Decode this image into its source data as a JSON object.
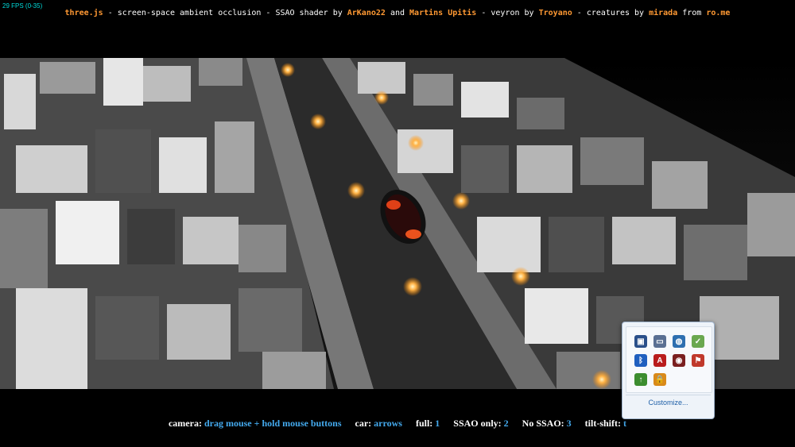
{
  "fps": "29 FPS (0-35)",
  "credits": {
    "lib": "three.js",
    "t1": " - screen-space ambient occlusion - SSAO shader by ",
    "a1": "ArKano22",
    "t2": " and ",
    "a2": "Martins Upitis",
    "t3": " - veyron by ",
    "a3": "Troyano",
    "t4": " - creatures by ",
    "a4": "mirada",
    "t5": " from ",
    "a5": "ro.me"
  },
  "controls": {
    "camera_label": "camera: ",
    "camera_value": "drag mouse + hold mouse buttons",
    "car_label": "car: ",
    "car_value": "arrows",
    "full_label": "full: ",
    "full_value": "1",
    "ssao_only_label": "SSAO only: ",
    "ssao_only_value": "2",
    "no_ssao_label": "No SSAO: ",
    "no_ssao_value": "3",
    "tilt_label": "tilt-shift: ",
    "tilt_value": "t"
  },
  "tray": {
    "customize_label": "Customize...",
    "icons": [
      {
        "name": "network-monitor-icon",
        "color": "#2a4f8a",
        "glyph": "▣"
      },
      {
        "name": "display-icon",
        "color": "#5a6f92",
        "glyph": "▭"
      },
      {
        "name": "globe-icon",
        "color": "#2e6fb0",
        "glyph": "◍"
      },
      {
        "name": "shield-check-icon",
        "color": "#6aa84f",
        "glyph": "✓"
      },
      {
        "name": "bluetooth-icon",
        "color": "#1f5fbf",
        "glyph": "ᛒ"
      },
      {
        "name": "adobe-icon",
        "color": "#b91c1c",
        "glyph": "A"
      },
      {
        "name": "eye-icon",
        "color": "#7a1f1f",
        "glyph": "◉"
      },
      {
        "name": "flag-icon",
        "color": "#c0392b",
        "glyph": "⚑"
      },
      {
        "name": "update-icon",
        "color": "#3c8d2f",
        "glyph": "↑"
      },
      {
        "name": "lock-icon",
        "color": "#d98a1a",
        "glyph": "🔒"
      }
    ]
  }
}
